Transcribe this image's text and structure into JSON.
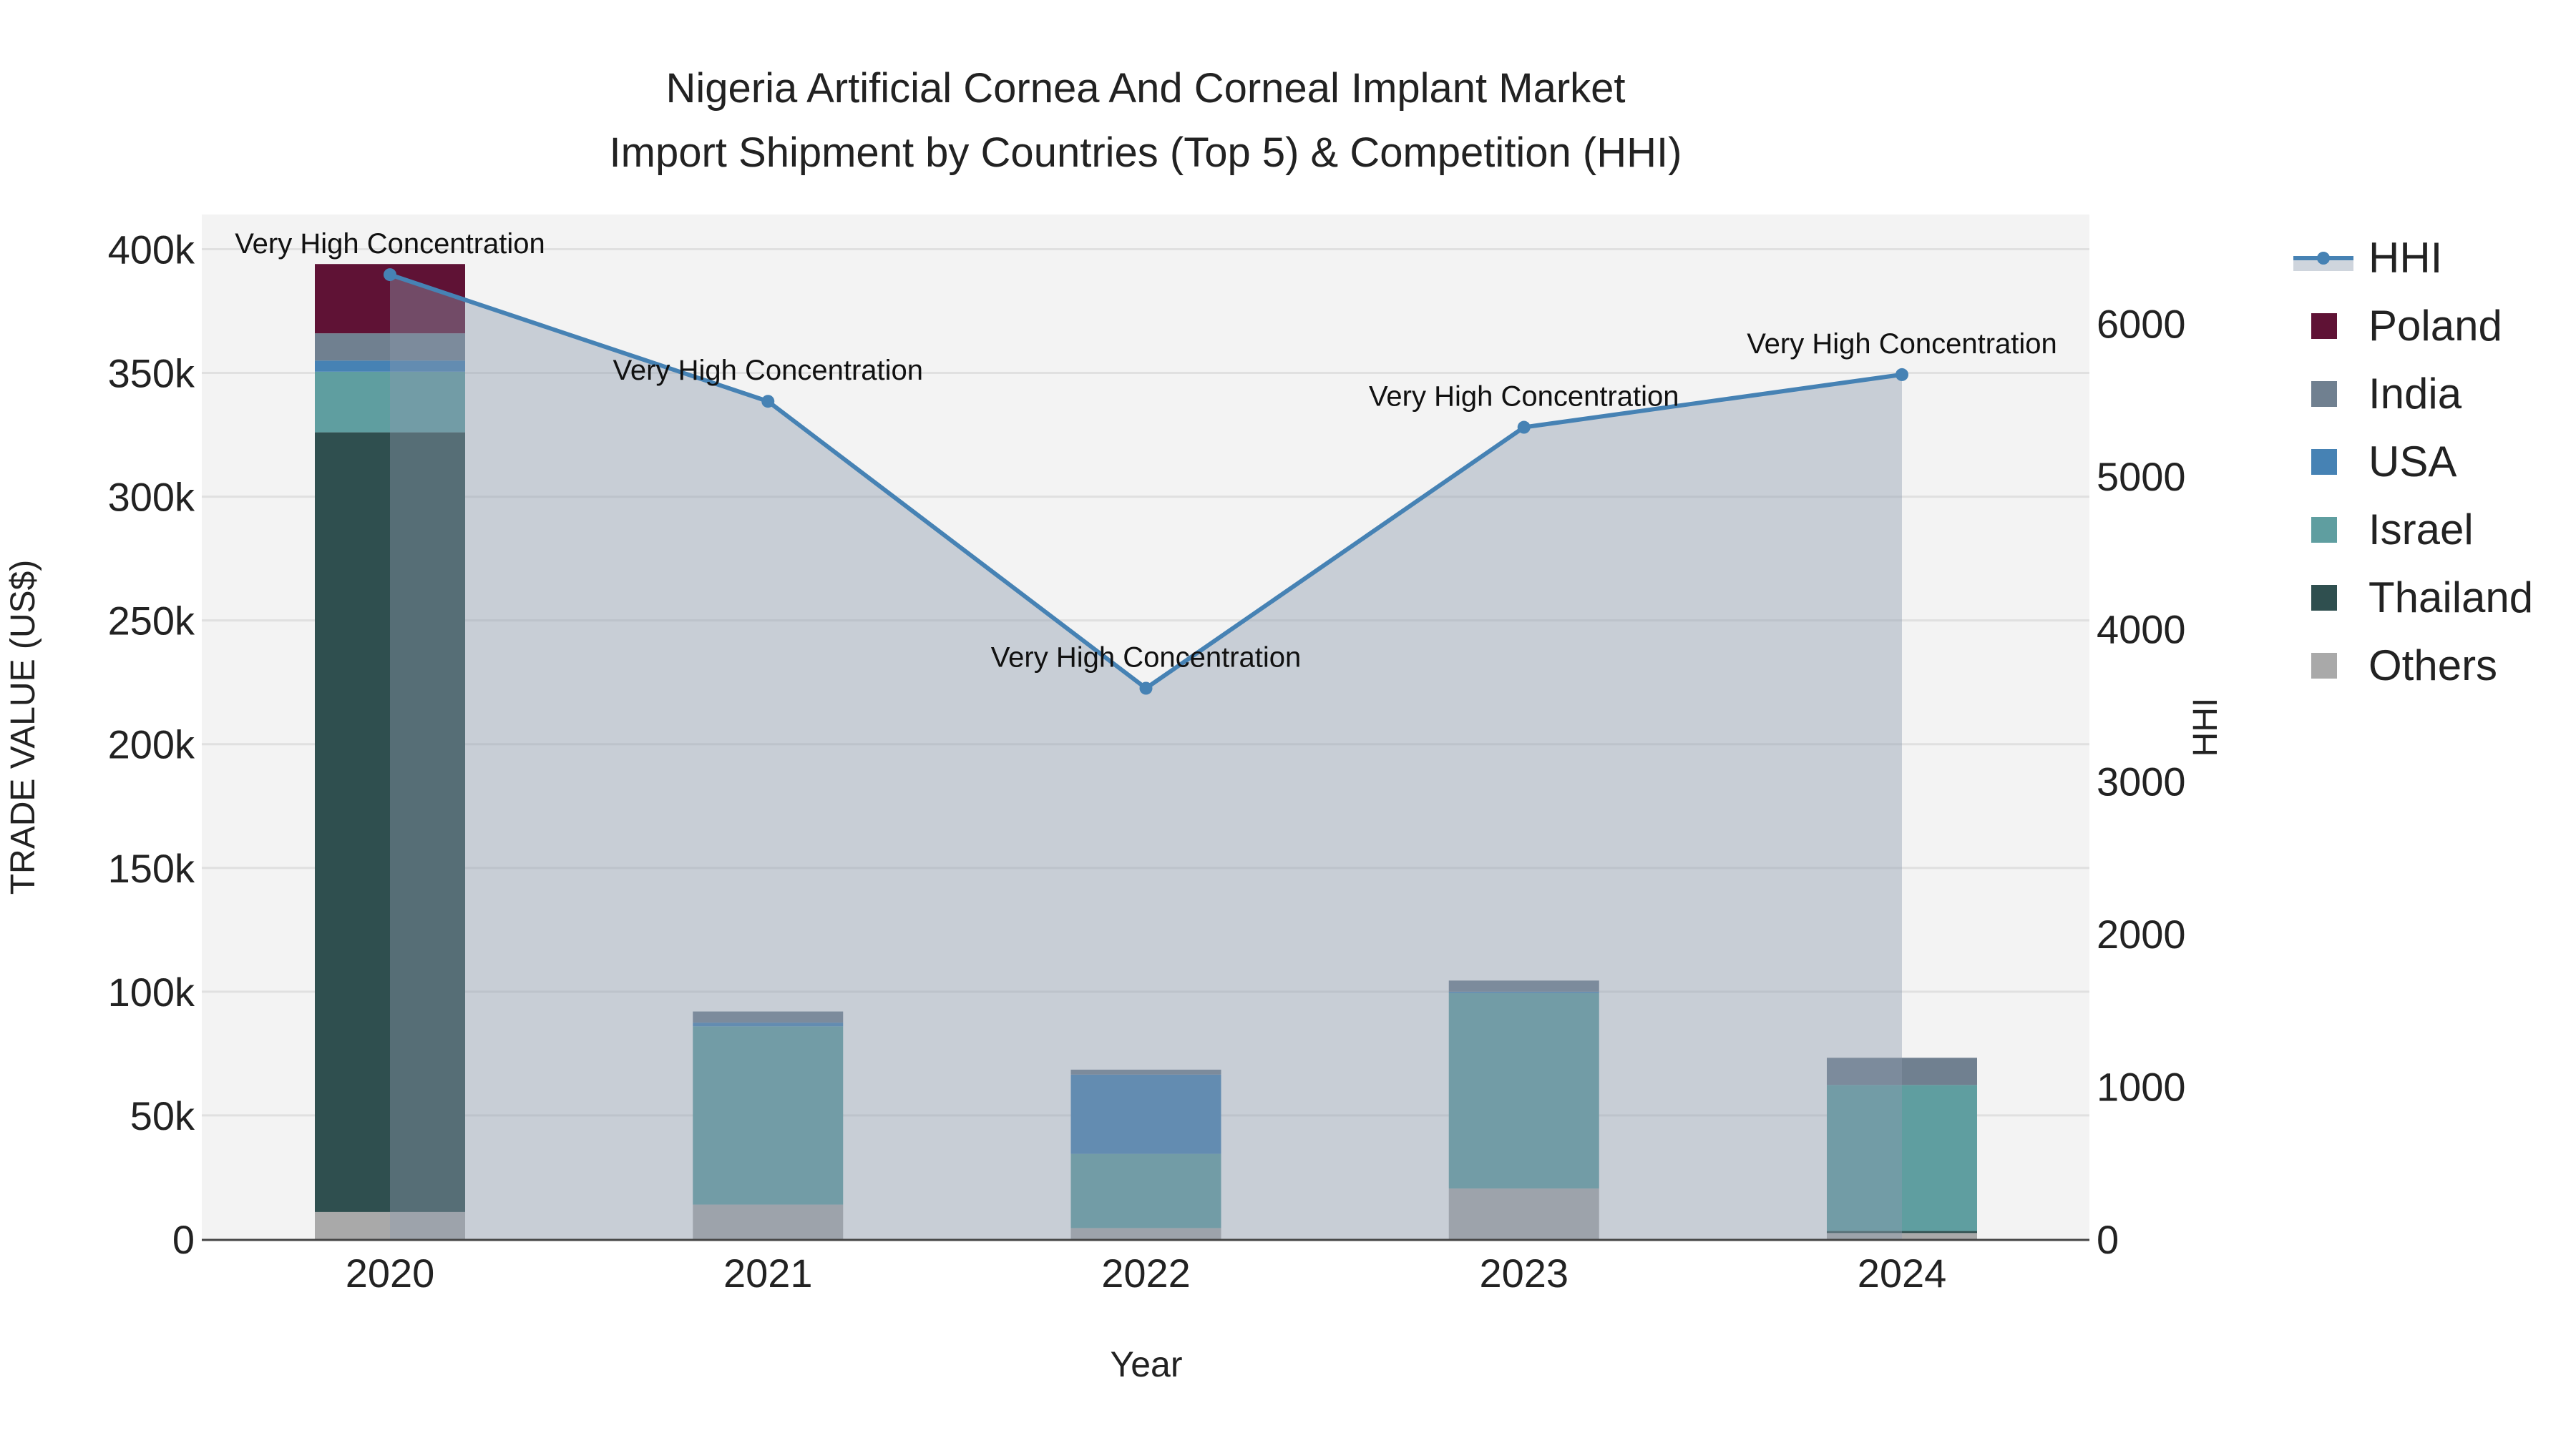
{
  "chart_data": {
    "type": "bar",
    "title_line1": "Nigeria Artificial Cornea And Corneal Implant Market",
    "title_line2": "Import Shipment by Countries (Top 5) & Competition (HHI)",
    "xlabel": "Year",
    "ylabel": "TRADE VALUE (US$)",
    "y2label": "HHI",
    "categories": [
      "2020",
      "2021",
      "2022",
      "2023",
      "2024"
    ],
    "ylim": [
      0,
      414000
    ],
    "y2lim": [
      0,
      6714
    ],
    "yticks": [
      0,
      50000,
      100000,
      150000,
      200000,
      250000,
      300000,
      350000,
      400000
    ],
    "ytick_labels": [
      "0",
      "50k",
      "100k",
      "150k",
      "200k",
      "250k",
      "300k",
      "350k",
      "400k"
    ],
    "y2ticks": [
      0,
      1000,
      2000,
      3000,
      4000,
      5000,
      6000
    ],
    "y2tick_labels": [
      "0",
      "1000",
      "2000",
      "3000",
      "4000",
      "5000",
      "6000"
    ],
    "grid": true,
    "legend_position": "right",
    "series": [
      {
        "name": "Others",
        "color": "#a9a9a9",
        "values": [
          11000,
          14000,
          4500,
          20500,
          2500
        ]
      },
      {
        "name": "Thailand",
        "color": "#2f4f4f",
        "values": [
          315000,
          0,
          0,
          0,
          800
        ]
      },
      {
        "name": "Israel",
        "color": "#5f9ea0",
        "values": [
          24500,
          72000,
          30000,
          79000,
          59000
        ]
      },
      {
        "name": "USA",
        "color": "#4682b4",
        "values": [
          4500,
          1500,
          32000,
          500,
          0
        ]
      },
      {
        "name": "India",
        "color": "#708090",
        "values": [
          11000,
          4500,
          2000,
          4500,
          11000
        ]
      },
      {
        "name": "Poland",
        "color": "#5f1235",
        "values": [
          28000,
          0,
          0,
          0,
          0
        ]
      }
    ],
    "hhi": {
      "name": "HHI",
      "color": "#4682b4",
      "values": [
        6320,
        5490,
        3610,
        5320,
        5665
      ],
      "annotations": [
        "Very High Concentration",
        "Very High Concentration",
        "Very High Concentration",
        "Very High Concentration",
        "Very High Concentration"
      ]
    },
    "legend": [
      "HHI",
      "Poland",
      "India",
      "USA",
      "Israel",
      "Thailand",
      "Others"
    ]
  }
}
